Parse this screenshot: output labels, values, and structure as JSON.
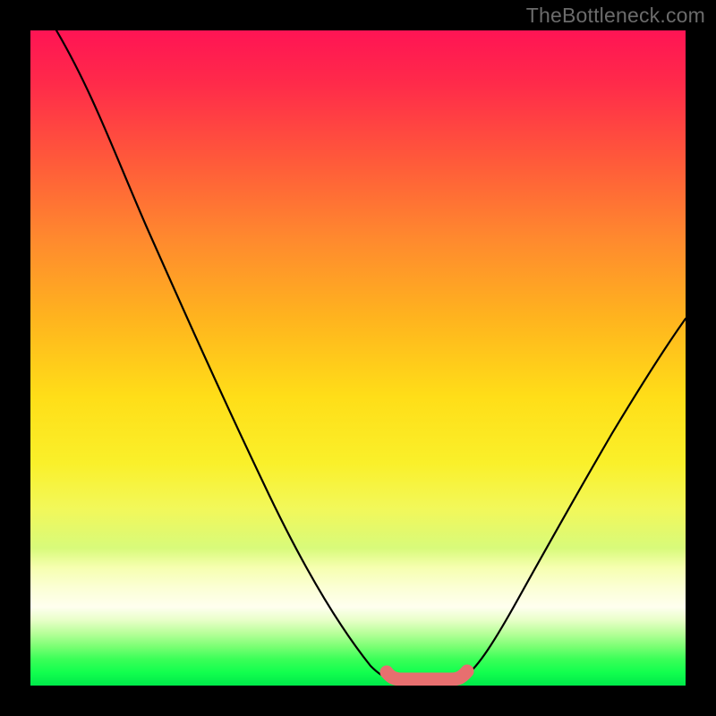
{
  "watermark": "TheBottleneck.com",
  "chart_data": {
    "type": "line",
    "title": "",
    "xlabel": "",
    "ylabel": "",
    "xlim": [
      0,
      100
    ],
    "ylim": [
      0,
      100
    ],
    "grid": false,
    "legend": false,
    "series": [
      {
        "name": "left-curve",
        "color": "#000000",
        "x": [
          4,
          10,
          16,
          22,
          28,
          34,
          40,
          46,
          50,
          54
        ],
        "values": [
          100,
          88,
          76,
          62,
          48,
          34,
          22,
          10,
          4,
          1.2
        ]
      },
      {
        "name": "right-curve",
        "color": "#000000",
        "x": [
          66,
          70,
          76,
          82,
          88,
          94,
          100
        ],
        "values": [
          1.5,
          6,
          16,
          27,
          38,
          48,
          56
        ]
      },
      {
        "name": "bottom-band",
        "color": "#e76f6f",
        "x": [
          54,
          57,
          60,
          63,
          66
        ],
        "values": [
          1.2,
          0.9,
          0.9,
          0.9,
          1.5
        ]
      }
    ]
  }
}
